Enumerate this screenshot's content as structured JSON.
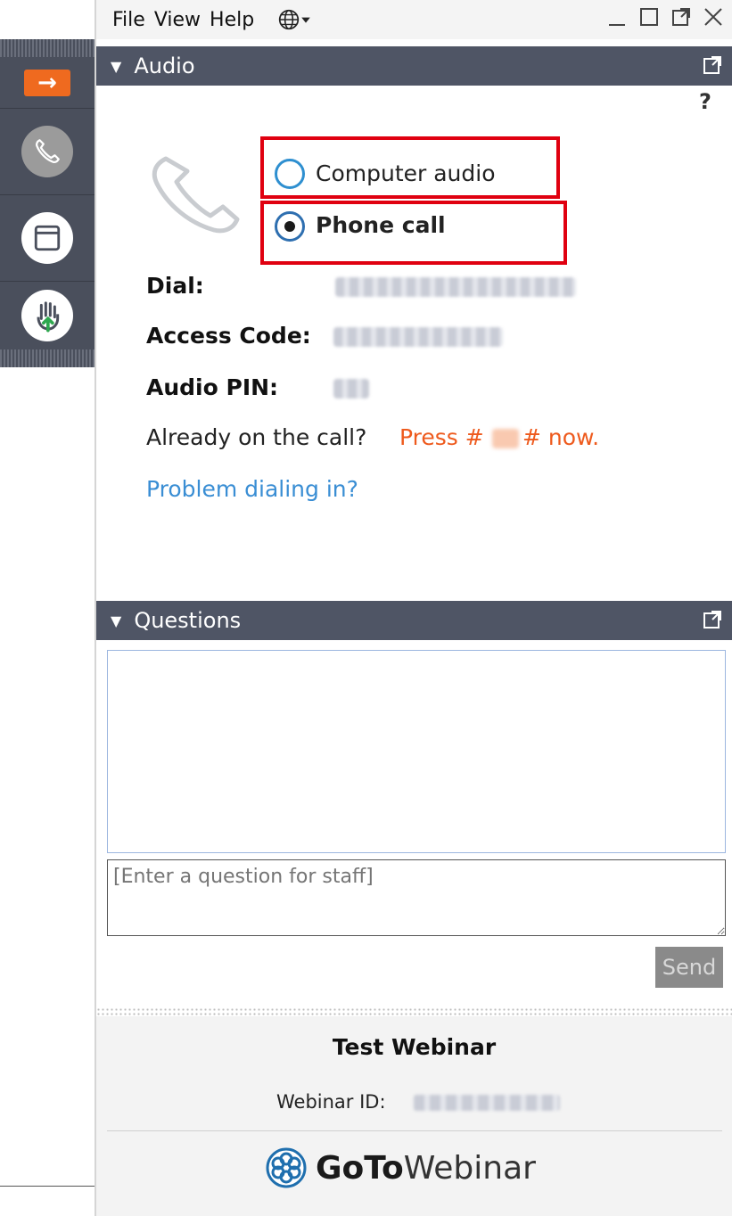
{
  "menu": {
    "file": "File",
    "view": "View",
    "help": "Help"
  },
  "audio": {
    "header": "Audio",
    "help": "?",
    "option_computer": "Computer audio",
    "option_phone": "Phone call",
    "selected": "Phone call",
    "dial_label": "Dial:",
    "access_code_label": "Access Code:",
    "audio_pin_label": "Audio PIN:",
    "already_text": "Already on the call?",
    "press_text": "Press #",
    "press_end": "# now.",
    "problem_link": "Problem dialing in?"
  },
  "questions": {
    "header": "Questions",
    "input_placeholder": "[Enter a question for staff]",
    "send_label": "Send"
  },
  "footer": {
    "title": "Test Webinar",
    "webinar_id_label": "Webinar ID:",
    "brand_bold": "GoTo",
    "brand_rest": "Webinar"
  },
  "colors": {
    "header_bg": "#4f5565",
    "accent_orange": "#ef6a1f",
    "link_blue": "#3a8ed4",
    "highlight_red": "#e00010"
  }
}
